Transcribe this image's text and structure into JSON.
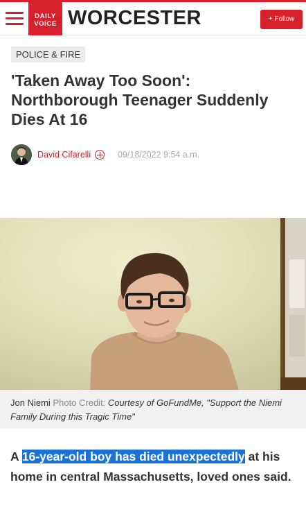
{
  "header": {
    "logo_line1": "DAILY",
    "logo_line2": "VOICE",
    "site_name": "WORCESTER",
    "follow_label": "+ Follow"
  },
  "article": {
    "category": "POLICE & FIRE",
    "headline": "'Taken Away Too Soon': Northborough Teenager Suddenly Dies At 16",
    "author": "David Cifarelli",
    "date": "09/18/2022 9:54 a.m.",
    "photo": {
      "caption_name": "Jon Niemi",
      "credit_label": "Photo Credit:",
      "credit": "Courtesy of GoFundMe, \"Support the Niemi Family During this Tragic Time\""
    },
    "lede_prefix": "A ",
    "lede_highlight": "16-year-old boy has died unexpectedly",
    "lede_suffix": " at his home in central Massachusetts, loved ones said."
  },
  "colors": {
    "brand_red": "#d6202c",
    "author_red": "#c4262e",
    "highlight_blue": "#1a72d6"
  },
  "icons": [
    "hamburger-menu-icon",
    "follow-plus-icon"
  ]
}
